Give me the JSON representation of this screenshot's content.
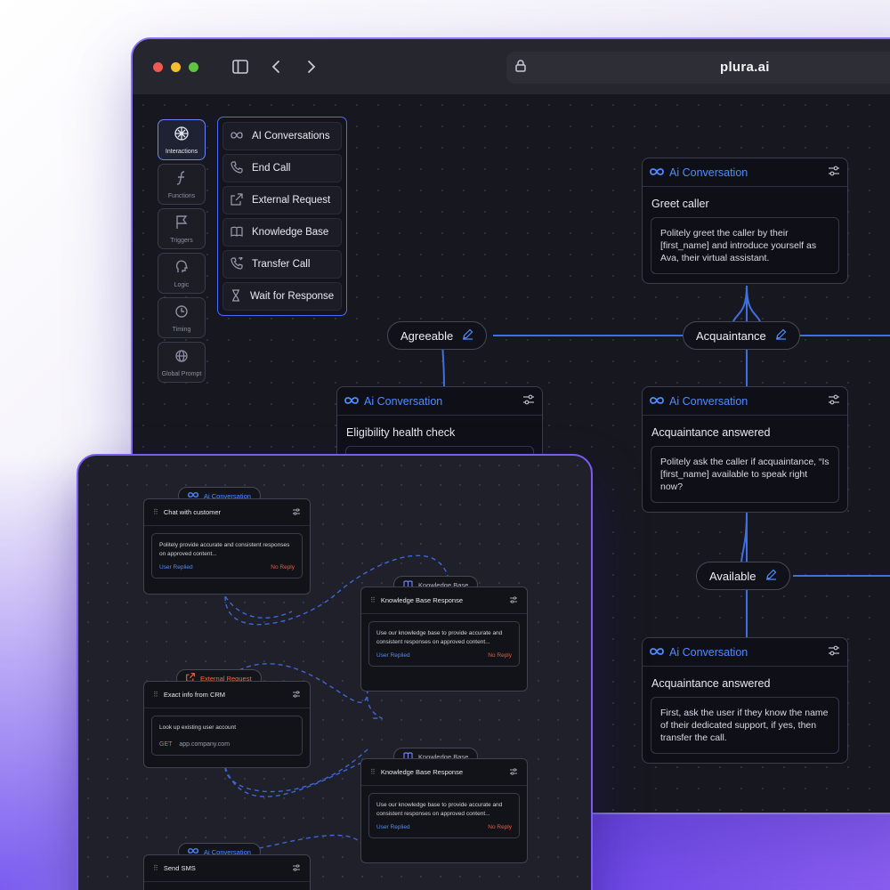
{
  "browser": {
    "url": "plura.ai"
  },
  "rail": [
    {
      "label": "Interactions",
      "icon": "openai-icon",
      "active": true
    },
    {
      "label": "Functions",
      "icon": "function-icon"
    },
    {
      "label": "Triggers",
      "icon": "flag-icon"
    },
    {
      "label": "Logic",
      "icon": "brain-icon"
    },
    {
      "label": "Timing",
      "icon": "clock-icon"
    },
    {
      "label": "Global Prompt",
      "icon": "globe-icon"
    }
  ],
  "menu": [
    {
      "label": "AI Conversations",
      "icon": "infinity-icon"
    },
    {
      "label": "End Call",
      "icon": "phone-icon"
    },
    {
      "label": "External Request",
      "icon": "external-link-icon"
    },
    {
      "label": "Knowledge Base",
      "icon": "book-icon"
    },
    {
      "label": "Transfer Call",
      "icon": "phone-transfer-icon"
    },
    {
      "label": "Wait for Response",
      "icon": "hourglass-icon"
    }
  ],
  "flow": {
    "node_type": "Ai Conversation",
    "nodes": [
      {
        "title": "Greet caller",
        "body": "Politely greet the caller by their [first_name] and introduce yourself as Ava, their virtual assistant."
      },
      {
        "title": "Eligibility health check",
        "body": ""
      },
      {
        "title": "Acquaintance answered",
        "body": "Politely ask the caller if acquaintance, “Is [first_name] available to speak right now?"
      },
      {
        "title": "Acquaintance answered",
        "body": "First, ask the user if they know the name of their dedicated support, if yes, then transfer the call."
      }
    ],
    "pills": [
      "Agreeable",
      "Acquaintance",
      "Available"
    ]
  },
  "front": {
    "tags": {
      "ai_conversation": "Ai Conversation",
      "knowledge_base": "Knowledge Base",
      "external_request": "External Request"
    },
    "nodes": [
      {
        "title": "Chat with customer",
        "body": "Politely provide accurate and consistent responses on approved content...",
        "left": "User Replied",
        "right": "No Reply"
      },
      {
        "title": "Knowledge Base Response",
        "body": "Use our knowledge base to provide accurate and consistent responses on approved content...",
        "left": "User Replied",
        "right": "No Reply"
      },
      {
        "title": "Exact info from CRM",
        "body": "Look up existing user account",
        "method": "GET",
        "endpoint": "app.company.com"
      },
      {
        "title": "Knowledge Base Response",
        "body": "Use our knowledge base to provide accurate and consistent responses on approved content...",
        "left": "User Replied",
        "right": "No Reply"
      },
      {
        "title": "Send SMS"
      }
    ]
  },
  "colors": {
    "accent_blue": "#4f8cff",
    "accent_purple": "#7c5cf0",
    "no_reply_red": "#ef5b3a"
  }
}
